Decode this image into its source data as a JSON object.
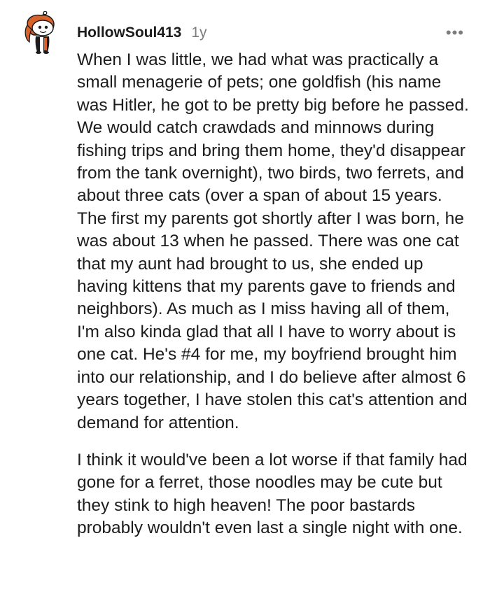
{
  "comment": {
    "author": "HollowSoul413",
    "age": "1y",
    "menu_label": "•••",
    "avatar_icon": "reddit-snoo-avatar-icon",
    "paragraphs": [
      "When I was little, we had what was practically a small menagerie of pets; one goldfish (his name was Hitler, he got to be pretty big before he passed. We would catch crawdads and minnows during fishing trips and bring them home, they'd disappear from the tank overnight), two birds, two ferrets, and about three cats (over a span of about 15 years. The first my parents got shortly after I was born, he was about 13 when he passed. There was one cat that my aunt had brought to us, she ended up having kittens that my parents gave to friends and neighbors). As much as I miss having all of them, I'm also kinda glad that all I have to worry about is one cat. He's #4 for me, my boyfriend brought him into our relationship, and I do believe after almost 6 years together, I have stolen this cat's attention and demand for attention.",
      "I think it would've been a lot worse if that family had gone for a ferret, those noodles may be cute but they stink to high heaven! The poor bastards probably wouldn't even last a single night with one."
    ]
  },
  "colors": {
    "text": "#1c1c1c",
    "meta": "#7c7c7c",
    "avatar_hair": "#d9622b",
    "avatar_body": "#1c1c1c",
    "avatar_skin": "#ffffff"
  }
}
